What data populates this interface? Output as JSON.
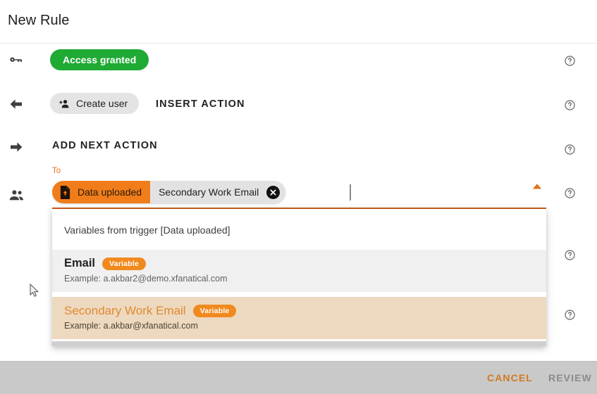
{
  "header": {
    "title": "New Rule"
  },
  "rows": [
    {
      "icon": "key-icon",
      "chip_label": "Access granted",
      "help": "help-icon"
    },
    {
      "icon": "arrow-left-icon",
      "chip_label": "Create user",
      "secondary_label": "INSERT ACTION",
      "help": "help-icon"
    },
    {
      "icon": "arrow-right-icon",
      "label": "ADD NEXT ACTION",
      "help": "help-icon"
    },
    {
      "icon": "people-icon",
      "help": "help-icon"
    }
  ],
  "to_field": {
    "label": "To",
    "source_token": {
      "icon": "file-upload-icon",
      "label": "Data uploaded"
    },
    "variable_token": {
      "label": "Secondary Work Email",
      "remove_icon": "close-circle-icon"
    },
    "collapse_icon": "chevron-up-icon"
  },
  "dropdown": {
    "header": "Variables from trigger [Data uploaded]",
    "items": [
      {
        "title": "Email",
        "badge": "Variable",
        "example": "Example: a.akbar2@demo.xfanatical.com",
        "selected": false
      },
      {
        "title": "Secondary Work Email",
        "badge": "Variable",
        "example": "Example: a.akbar@xfanatical.com",
        "selected": true
      }
    ]
  },
  "footer": {
    "cancel_label": "CANCEL",
    "review_label": "REVIEW"
  },
  "colors": {
    "accent_orange": "#f07d1a",
    "accent_orange_dark": "#cf5c1a",
    "green": "#1faa34",
    "footer_bg": "#c9c9c9",
    "highlight_row": "#edd9bf"
  }
}
